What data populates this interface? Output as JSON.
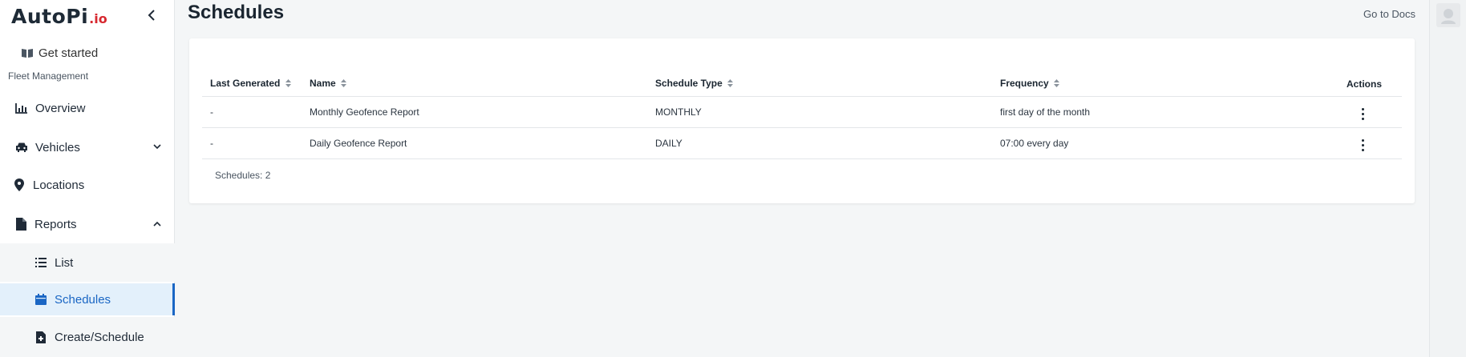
{
  "brand": {
    "logo_main": "AutoPi",
    "logo_suffix": ".io",
    "accent": "#d7282f"
  },
  "sidebar": {
    "collapse_icon": "chevron-left-icon",
    "get_started": "Get started",
    "section_label": "Fleet Management",
    "items": [
      {
        "label": "Overview",
        "icon": "bar-chart-icon"
      },
      {
        "label": "Vehicles",
        "icon": "car-icon",
        "chevron": "chevron-down"
      },
      {
        "label": "Locations",
        "icon": "map-pin-icon"
      },
      {
        "label": "Reports",
        "icon": "document-icon",
        "chevron": "chevron-up"
      },
      {
        "label": "List",
        "icon": "list-icon",
        "sub": true
      },
      {
        "label": "Schedules",
        "icon": "calendar-icon",
        "sub": true,
        "active": true
      },
      {
        "label": "Create/Schedule",
        "icon": "file-add-icon",
        "sub": true
      }
    ],
    "active_color": "#1a66c4"
  },
  "header": {
    "title": "Schedules",
    "docs_link": "Go to Docs"
  },
  "table": {
    "columns": [
      "Last Generated",
      "Name",
      "Schedule Type",
      "Frequency",
      "Actions"
    ],
    "rows": [
      {
        "last_generated": "-",
        "name": "Monthly Geofence Report",
        "type": "MONTHLY",
        "frequency": "first day of the month"
      },
      {
        "last_generated": "-",
        "name": "Daily Geofence Report",
        "type": "DAILY",
        "frequency": "07:00 every day"
      }
    ],
    "footer": "Schedules: 2"
  }
}
